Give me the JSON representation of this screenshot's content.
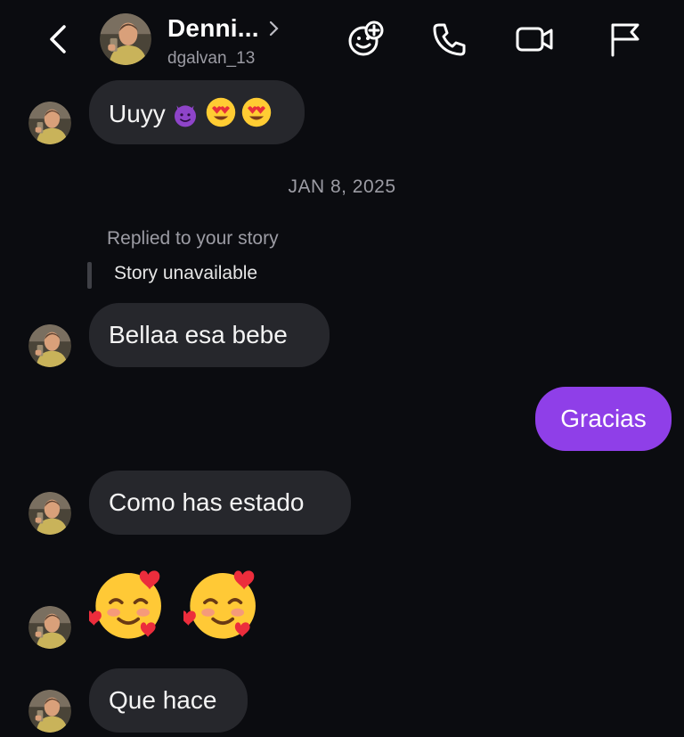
{
  "header": {
    "contact_name": "Denni...",
    "username": "dgalvan_13"
  },
  "messages": {
    "m1": "Uuyy",
    "date_separator": "JAN 8, 2025",
    "story_reply_label": "Replied to your story",
    "story_status": "Story unavailable",
    "m2": "Bellaa esa bebe",
    "m3_out": "Gracias",
    "m4": "Como has estado",
    "m6": "Que hace"
  },
  "icons": {
    "back": "chevron-left-icon",
    "header_chevron": "chevron-right-icon",
    "effects": "smiley-plus-icon",
    "call": "phone-icon",
    "video": "video-camera-icon",
    "report": "flag-icon",
    "m1_emojis": [
      "smiling-devil-emoji",
      "heart-eyes-emoji",
      "heart-eyes-emoji"
    ],
    "m5_emojis": [
      "smiling-face-with-hearts-emoji",
      "smiling-face-with-hearts-emoji"
    ]
  },
  "colors": {
    "background": "#0b0c10",
    "incoming_bubble": "#26272c",
    "outgoing_bubble": "#8f3fe8",
    "secondary_text": "#9c9ca4"
  }
}
